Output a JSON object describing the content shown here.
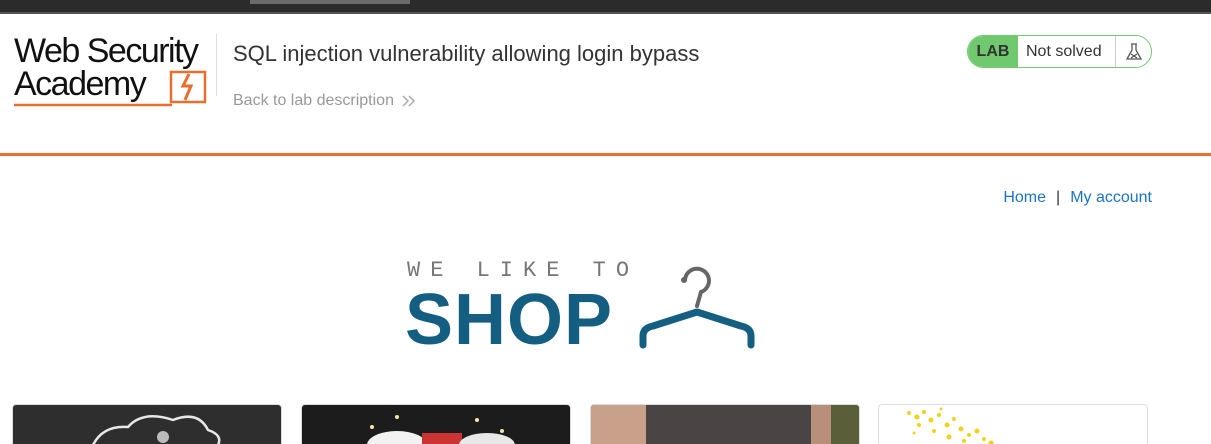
{
  "header": {
    "logo_line1": "Web Security",
    "logo_line2": "Academy",
    "lab_title": "SQL injection vulnerability allowing login bypass",
    "back_link": "Back to lab description",
    "status_badge": "LAB",
    "status_text": "Not solved"
  },
  "nav": {
    "home": "Home",
    "separator": "|",
    "my_account": "My account"
  },
  "shop_logo": {
    "tagline": "WE LIKE TO",
    "word": "SHOP"
  },
  "colors": {
    "accent_orange": "#ea6f2d",
    "lab_green": "#70c96f",
    "link_blue": "#1a73c8",
    "shop_blue": "#145e82"
  },
  "products": [
    {
      "name": "product-card-1"
    },
    {
      "name": "product-card-2"
    },
    {
      "name": "product-card-3"
    },
    {
      "name": "product-card-4"
    }
  ]
}
